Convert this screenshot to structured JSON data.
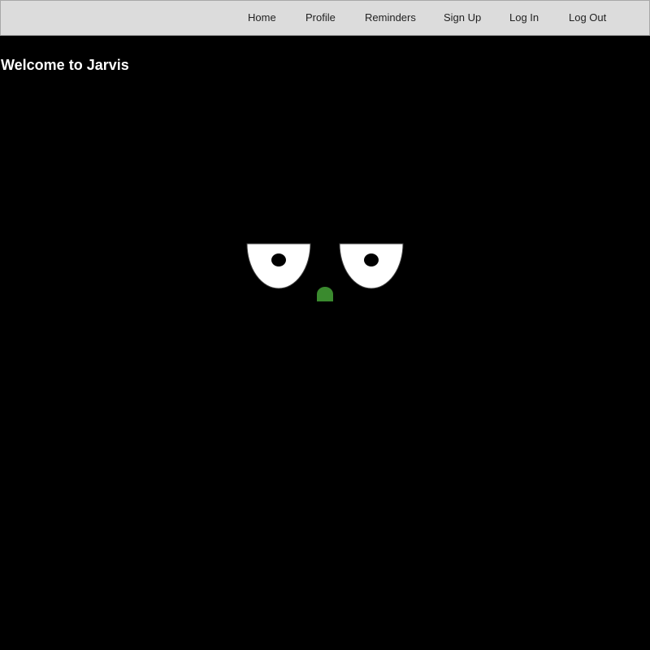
{
  "nav": {
    "items": [
      {
        "label": "Home"
      },
      {
        "label": "Profile"
      },
      {
        "label": "Reminders"
      },
      {
        "label": "Sign Up"
      },
      {
        "label": "Log In"
      },
      {
        "label": "Log Out"
      }
    ]
  },
  "page": {
    "title": "Welcome to Jarvis"
  },
  "colors": {
    "background": "#000000",
    "navbar": "#dcdcdc",
    "nose": "#3a8a2e",
    "eye_white": "#ffffff"
  }
}
